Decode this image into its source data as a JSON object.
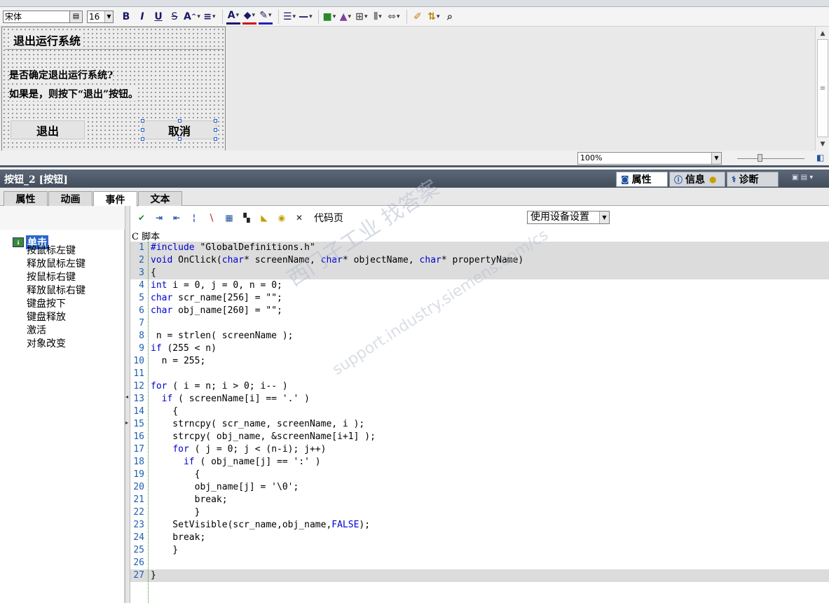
{
  "toolbar": {
    "font_name": "宋体",
    "font_size": "16"
  },
  "dialog": {
    "title": "退出运行系统",
    "line1": "是否确定退出运行系统?",
    "line2": "如果是，则按下“退出”按钮。",
    "exit_button": "退出",
    "cancel_button": "取消"
  },
  "status": {
    "zoom": "100%"
  },
  "properties": {
    "object_title": "按钮_2 [按钮]",
    "tabs": [
      "属性",
      "信息",
      "诊断"
    ],
    "subtabs": [
      "属性",
      "动画",
      "事件",
      "文本"
    ],
    "active_subtab": "事件"
  },
  "events": {
    "selected": "单击",
    "items": [
      "按鼠标左键",
      "释放鼠标左键",
      "按鼠标右键",
      "释放鼠标右键",
      "键盘按下",
      "键盘释放",
      "激活",
      "对象改变"
    ]
  },
  "editor": {
    "codepage_label": "代码页",
    "codepage_value": "使用设备设置",
    "script_label": "C 脚本",
    "lines": [
      {
        "n": "1",
        "text": "#include \"GlobalDefinitions.h\""
      },
      {
        "n": "2",
        "text": "void OnClick(char* screenName, char* objectName, char* propertyName)"
      },
      {
        "n": "3",
        "text": "{"
      },
      {
        "n": "4",
        "text": "int i = 0, j = 0, n = 0;"
      },
      {
        "n": "5",
        "text": "char scr_name[256] = \"\";"
      },
      {
        "n": "6",
        "text": "char obj_name[260] = \"\";"
      },
      {
        "n": "7",
        "text": ""
      },
      {
        "n": "8",
        "text": " n = strlen( screenName );"
      },
      {
        "n": "9",
        "text": "if (255 < n)"
      },
      {
        "n": "10",
        "text": "  n = 255;"
      },
      {
        "n": "11",
        "text": ""
      },
      {
        "n": "12",
        "text": "for ( i = n; i > 0; i-- )"
      },
      {
        "n": "13",
        "text": "  if ( screenName[i] == '.' )"
      },
      {
        "n": "14",
        "text": "    {"
      },
      {
        "n": "15",
        "text": "    strncpy( scr_name, screenName, i );"
      },
      {
        "n": "16",
        "text": "    strcpy( obj_name, &screenName[i+1] );"
      },
      {
        "n": "17",
        "text": "    for ( j = 0; j < (n-i); j++)"
      },
      {
        "n": "18",
        "text": "      if ( obj_name[j] == ':' )"
      },
      {
        "n": "19",
        "text": "        {"
      },
      {
        "n": "20",
        "text": "        obj_name[j] = '\\0';"
      },
      {
        "n": "21",
        "text": "        break;"
      },
      {
        "n": "22",
        "text": "        }"
      },
      {
        "n": "23",
        "text": "    SetVisible(scr_name,obj_name,FALSE);"
      },
      {
        "n": "24",
        "text": "    break;"
      },
      {
        "n": "25",
        "text": "    }"
      },
      {
        "n": "26",
        "text": ""
      },
      {
        "n": "27",
        "text": "}"
      }
    ],
    "highlighted_lines": [
      1,
      2,
      3,
      27
    ]
  },
  "watermark": {
    "line1": "西门子工业 找答案",
    "line2": "support.industry.siemens.com/cs"
  },
  "colors": {
    "keyword": "#0000d0",
    "line_number": "#1f5faf",
    "selection": "#2b66c9",
    "header": "#4e5a68"
  }
}
